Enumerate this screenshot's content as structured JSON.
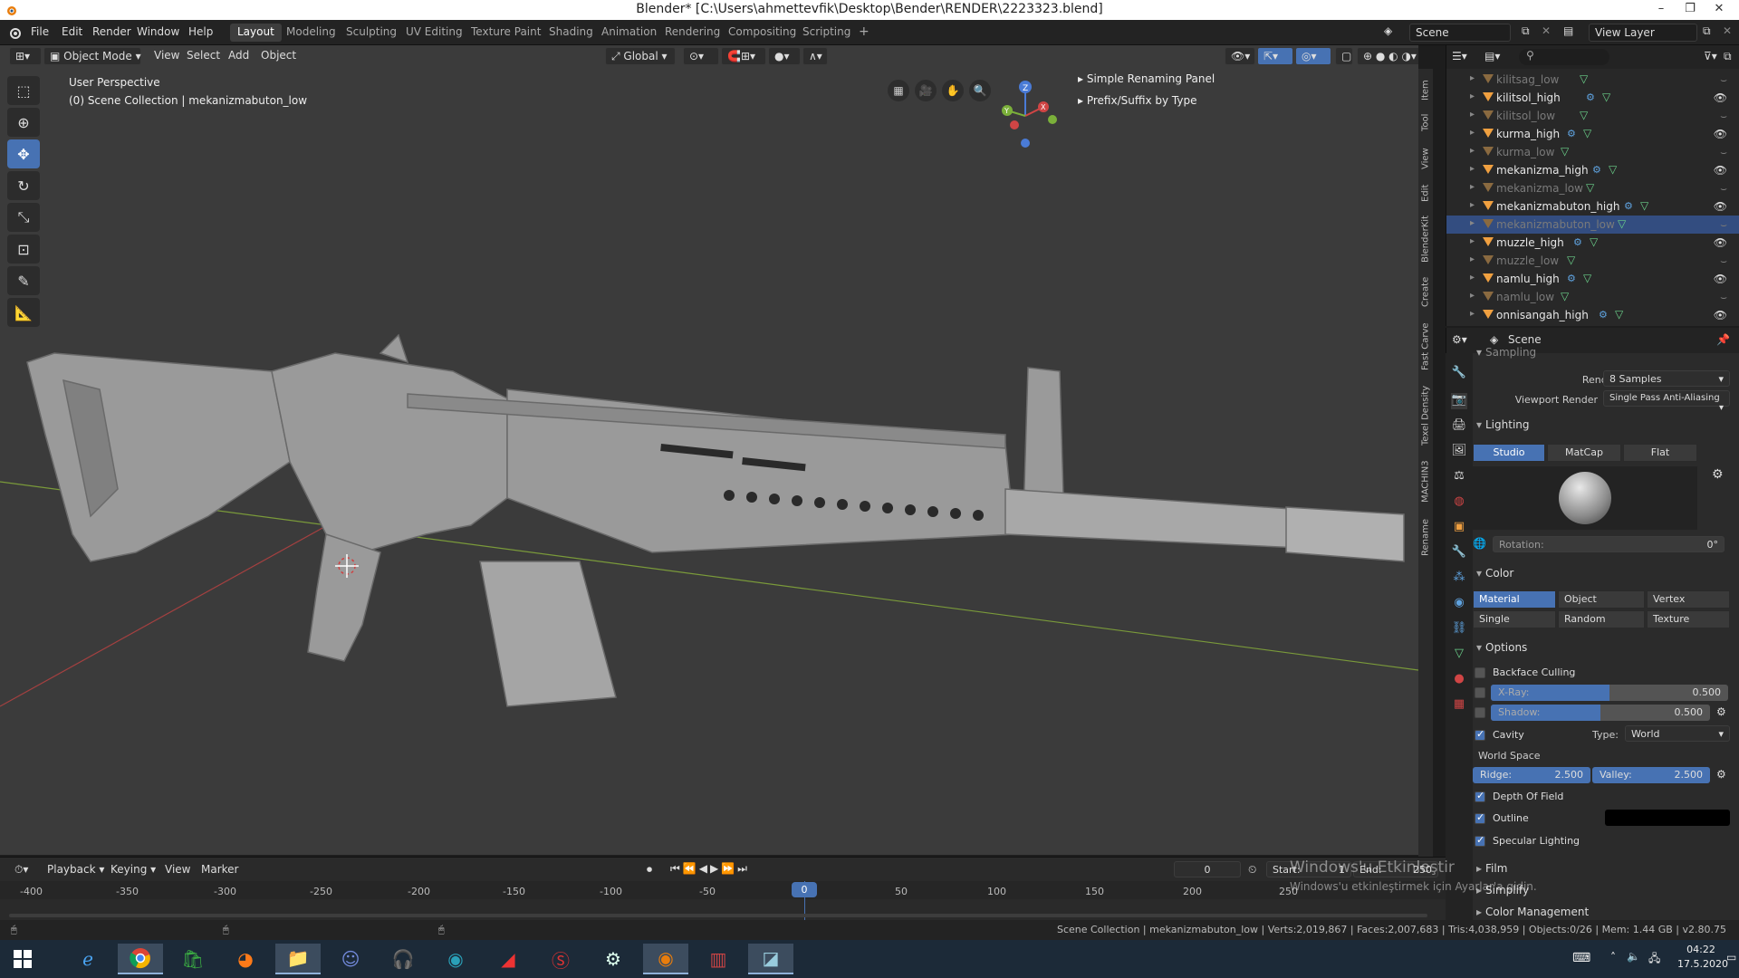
{
  "window": {
    "title": "Blender* [C:\\Users\\ahmettevfik\\Desktop\\Bender\\RENDER\\2223323.blend]"
  },
  "menus": [
    "File",
    "Edit",
    "Render",
    "Window",
    "Help"
  ],
  "workspaces": [
    "Layout",
    "Modeling",
    "Sculpting",
    "UV Editing",
    "Texture Paint",
    "Shading",
    "Animation",
    "Rendering",
    "Compositing",
    "Scripting"
  ],
  "active_workspace": "Layout",
  "scene_name": "Scene",
  "view_layer": "View Layer",
  "viewport": {
    "mode": "Object Mode",
    "header_menus": [
      "View",
      "Select",
      "Add",
      "Object"
    ],
    "orientation": "Global",
    "perspective": "User Perspective",
    "collection_info": "(0) Scene Collection | mekanizmabuton_low",
    "panels": [
      "Simple Renaming Panel",
      "Prefix/Suffix by Type"
    ]
  },
  "gizmo_axes": {
    "z": "Z",
    "y": "Y",
    "x": "X"
  },
  "n_tabs": [
    "Item",
    "Tool",
    "View",
    "Edit",
    "BlenderKit",
    "Create",
    "Fast Carve",
    "Texel Density",
    "MACHIN3",
    "Rename"
  ],
  "outliner": [
    {
      "name": "kilitsag_low",
      "low": true
    },
    {
      "name": "kilitsol_high",
      "low": false
    },
    {
      "name": "kilitsol_low",
      "low": true
    },
    {
      "name": "kurma_high",
      "low": false
    },
    {
      "name": "kurma_low",
      "low": true
    },
    {
      "name": "mekanizma_high",
      "low": false
    },
    {
      "name": "mekanizma_low",
      "low": true
    },
    {
      "name": "mekanizmabuton_high",
      "low": false
    },
    {
      "name": "mekanizmabuton_low",
      "low": true,
      "selected": true
    },
    {
      "name": "muzzle_high",
      "low": false
    },
    {
      "name": "muzzle_low",
      "low": true
    },
    {
      "name": "namlu_high",
      "low": false
    },
    {
      "name": "namlu_low",
      "low": true
    },
    {
      "name": "onnisangah_high",
      "low": false
    }
  ],
  "properties": {
    "context": "Scene",
    "sampling_label": "Sampling",
    "render_label": "Render",
    "render_value": "8 Samples",
    "viewport_render_label": "Viewport Render",
    "viewport_render_value": "Single Pass Anti-Aliasing",
    "lighting": {
      "title": "Lighting",
      "modes": [
        "Studio",
        "MatCap",
        "Flat"
      ],
      "active": "Studio",
      "rotation_label": "Rotation:",
      "rotation_value": "0°"
    },
    "color": {
      "title": "Color",
      "row1": [
        "Material",
        "Object",
        "Vertex"
      ],
      "row2": [
        "Single",
        "Random",
        "Texture"
      ],
      "active": "Material"
    },
    "options": {
      "title": "Options",
      "backface_culling": "Backface Culling",
      "xray_label": "X-Ray:",
      "xray_value": "0.500",
      "xray_fill": 0.5,
      "shadow_label": "Shadow:",
      "shadow_value": "0.500",
      "shadow_fill": 0.5,
      "cavity_label": "Cavity",
      "type_label": "Type:",
      "type_value": "World",
      "world_space": "World Space",
      "ridge_label": "Ridge:",
      "ridge_value": "2.500",
      "valley_label": "Valley:",
      "valley_value": "2.500",
      "dof": "Depth Of Field",
      "outline": "Outline",
      "specular": "Specular Lighting"
    },
    "collapsed": [
      "Film",
      "Simplify",
      "Color Management"
    ]
  },
  "timeline": {
    "menus": [
      "Playback",
      "Keying",
      "View",
      "Marker"
    ],
    "current_frame": "0",
    "start_label": "Start:",
    "start_value": "1",
    "end_label": "End:",
    "end_value": "250",
    "ticks": [
      "-400",
      "-350",
      "-300",
      "-250",
      "-200",
      "-150",
      "-100",
      "-50",
      "0",
      "50",
      "100",
      "150",
      "200",
      "250"
    ]
  },
  "watermark": {
    "line1": "Windows'u Etkinleştir",
    "line2": "Windows'u etkinleştirmek için Ayarlar'a gidin."
  },
  "status": "Scene Collection | mekanizmabuton_low | Verts:2,019,867 | Faces:2,007,683 | Tris:4,038,959 | Objects:0/26 | Mem: 1.44 GB | v2.80.75",
  "clock": {
    "time": "04:22",
    "date": "17.5.2020"
  },
  "taskbar_apps": [
    "windows-start",
    "internet-explorer",
    "chrome",
    "store",
    "firefox",
    "file-explorer",
    "discord",
    "headphones-app",
    "app-circle",
    "app-dark",
    "app-red",
    "steam",
    "blender",
    "winrar",
    "app-blue"
  ]
}
